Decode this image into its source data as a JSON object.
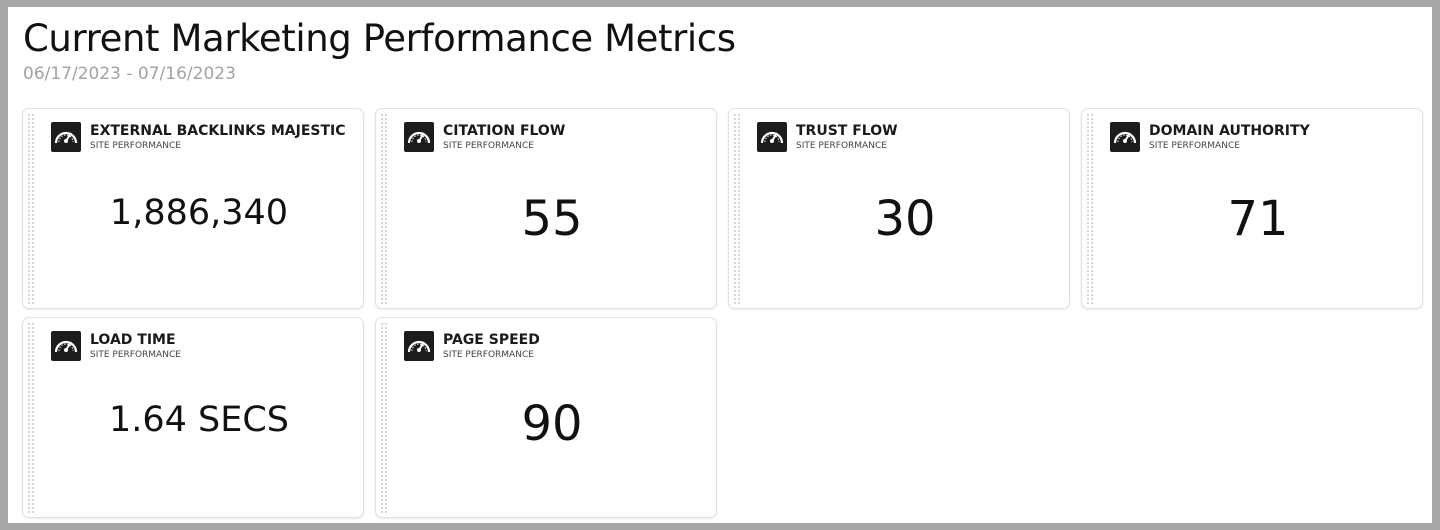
{
  "header": {
    "title": "Current Marketing Performance Metrics",
    "date_range": "06/17/2023 - 07/16/2023"
  },
  "colors": {
    "accent": "#1c1c1c",
    "card_border": "#e1e1e1",
    "muted_text": "#a2a2a2"
  },
  "cards": [
    {
      "title": "EXTERNAL BACKLINKS MAJESTIC",
      "subtitle": "SITE PERFORMANCE",
      "value": "1,886,340",
      "icon": "gauge-icon"
    },
    {
      "title": "CITATION FLOW",
      "subtitle": "SITE PERFORMANCE",
      "value": "55",
      "icon": "gauge-icon"
    },
    {
      "title": "TRUST FLOW",
      "subtitle": "SITE PERFORMANCE",
      "value": "30",
      "icon": "gauge-icon"
    },
    {
      "title": "DOMAIN AUTHORITY",
      "subtitle": "SITE PERFORMANCE",
      "value": "71",
      "icon": "gauge-icon"
    },
    {
      "title": "LOAD TIME",
      "subtitle": "SITE PERFORMANCE",
      "value": "1.64 SECS",
      "icon": "gauge-icon"
    },
    {
      "title": "PAGE SPEED",
      "subtitle": "SITE PERFORMANCE",
      "value": "90",
      "icon": "gauge-icon"
    }
  ]
}
